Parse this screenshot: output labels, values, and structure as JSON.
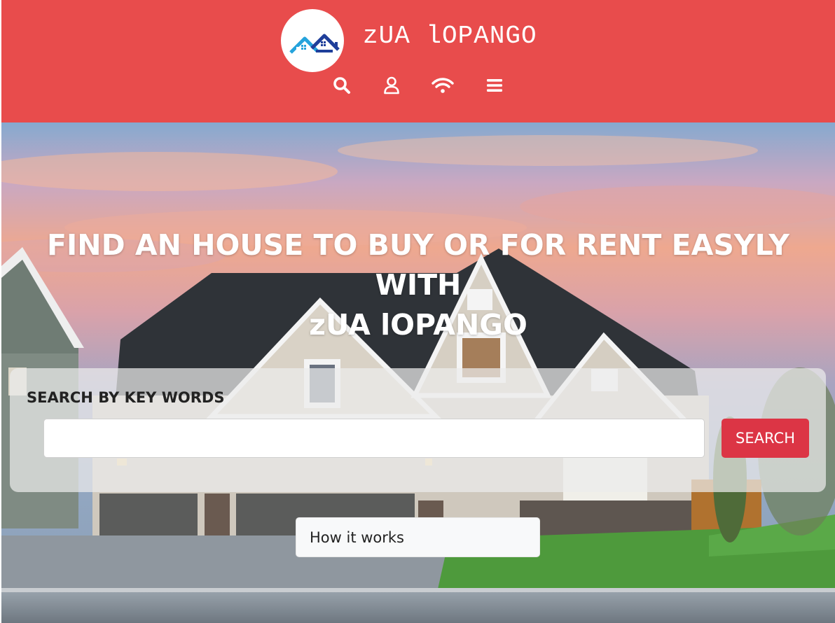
{
  "header": {
    "brand_name": "zUA lOPANGO",
    "colors": {
      "background": "#e84c4c",
      "logo_blue": "#1f3f9a",
      "logo_cyan": "#25a3dc"
    },
    "nav_icons": [
      "search-icon",
      "user-icon",
      "wifi-icon",
      "menu-icon"
    ]
  },
  "hero": {
    "title_line1": "FIND AN HOUSE TO BUY OR FOR RENT EASYLY",
    "title_line2": "WITH",
    "title_line3": "zUA lOPANGO",
    "search": {
      "label": "SEARCH BY KEY WORDS",
      "input_value": "",
      "placeholder": "",
      "button_label": "SEARCH",
      "button_color": "#dc3545"
    },
    "how_it_works_label": "How it works"
  }
}
